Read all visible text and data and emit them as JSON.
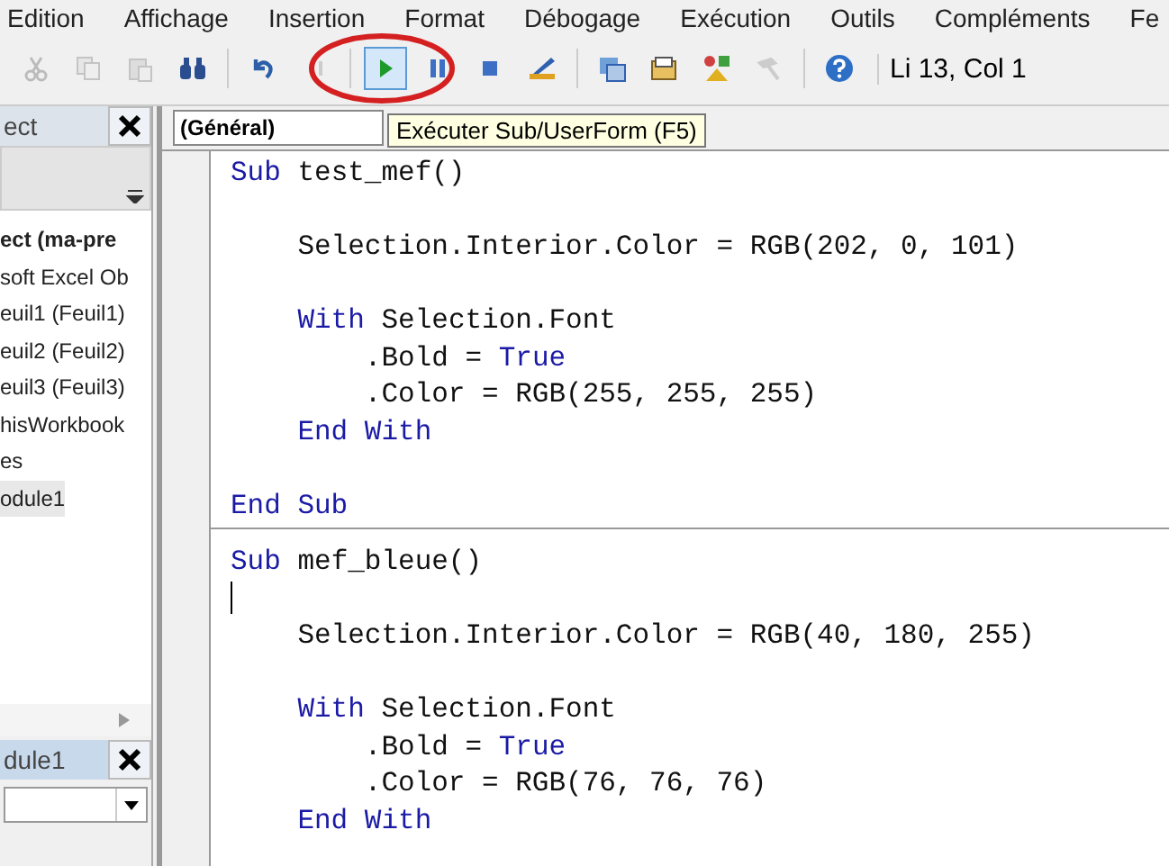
{
  "menu": [
    "Edition",
    "Affichage",
    "Insertion",
    "Format",
    "Débogage",
    "Exécution",
    "Outils",
    "Compléments",
    "Fe"
  ],
  "toolbar": {
    "buttons": [
      {
        "kind": "button",
        "disabled": true,
        "selected": false
      },
      {
        "kind": "button",
        "disabled": true,
        "selected": false
      },
      {
        "kind": "button",
        "disabled": true,
        "selected": false
      },
      {
        "kind": "button",
        "disabled": false,
        "selected": false
      },
      {
        "kind": "separator"
      },
      {
        "kind": "button",
        "disabled": false,
        "selected": false
      },
      {
        "kind": "button",
        "disabled": true,
        "selected": false
      },
      {
        "kind": "separator"
      },
      {
        "kind": "button",
        "disabled": false,
        "selected": true
      },
      {
        "kind": "button",
        "disabled": false,
        "selected": false
      },
      {
        "kind": "button",
        "disabled": false,
        "selected": false
      },
      {
        "kind": "button",
        "disabled": false,
        "selected": false
      },
      {
        "kind": "separator"
      },
      {
        "kind": "button",
        "disabled": false,
        "selected": false
      },
      {
        "kind": "button",
        "disabled": false,
        "selected": false
      },
      {
        "kind": "button",
        "disabled": false,
        "selected": false
      },
      {
        "kind": "button",
        "disabled": true,
        "selected": false
      },
      {
        "kind": "separator"
      },
      {
        "kind": "button",
        "disabled": false,
        "selected": false
      }
    ],
    "position": "Li 13, Col 1"
  },
  "project_panel": {
    "title": "ect",
    "items": [
      {
        "label": "ect (ma-pre",
        "bold": true,
        "selected": false
      },
      {
        "label": "soft Excel Ob",
        "bold": false,
        "selected": false
      },
      {
        "label": "euil1 (Feuil1)",
        "bold": false,
        "selected": false
      },
      {
        "label": "euil2 (Feuil2)",
        "bold": false,
        "selected": false
      },
      {
        "label": "euil3 (Feuil3)",
        "bold": false,
        "selected": false
      },
      {
        "label": "hisWorkbook",
        "bold": false,
        "selected": false
      },
      {
        "label": "es",
        "bold": false,
        "selected": false
      },
      {
        "label": "odule1",
        "bold": false,
        "selected": true
      }
    ]
  },
  "properties_panel": {
    "title": "dule1"
  },
  "editor": {
    "object_dropdown": "(Général)",
    "tooltip": "Exécuter Sub/UserForm (F5)",
    "procedures": [
      {
        "lines": [
          {
            "kind": "code",
            "tokens": [
              {
                "kind": "kw",
                "text": "Sub"
              },
              {
                "kind": "plain",
                "text": "test_mef()"
              }
            ]
          },
          {
            "kind": "group",
            "children": [
              {
                "kind": "blank"
              },
              {
                "kind": "code",
                "tokens": [
                  {
                    "kind": "plain",
                    "text": "Selection.Interior.Color = RGB(202, 0, 101)"
                  }
                ]
              },
              {
                "kind": "blank"
              },
              {
                "kind": "code",
                "tokens": [
                  {
                    "kind": "kw",
                    "text": "With"
                  },
                  {
                    "kind": "plain",
                    "text": "Selection.Font"
                  }
                ]
              },
              {
                "kind": "group",
                "children": [
                  {
                    "kind": "code",
                    "tokens": [
                      {
                        "kind": "plain",
                        "text": ".Bold ="
                      },
                      {
                        "kind": "kw",
                        "text": "True"
                      }
                    ]
                  },
                  {
                    "kind": "code",
                    "tokens": [
                      {
                        "kind": "plain",
                        "text": ".Color = RGB(255, 255, 255)"
                      }
                    ]
                  }
                ]
              },
              {
                "kind": "code",
                "tokens": [
                  {
                    "kind": "kw",
                    "text": "End With"
                  }
                ]
              },
              {
                "kind": "blank"
              }
            ]
          },
          {
            "kind": "code",
            "tokens": [
              {
                "kind": "kw",
                "text": "End Sub"
              }
            ]
          }
        ]
      },
      {
        "lines": [
          {
            "kind": "code",
            "tokens": [
              {
                "kind": "kw",
                "text": "Sub"
              },
              {
                "kind": "plain",
                "text": "mef_bleue()"
              }
            ]
          },
          {
            "kind": "cursor"
          },
          {
            "kind": "group",
            "children": [
              {
                "kind": "code",
                "tokens": [
                  {
                    "kind": "plain",
                    "text": "Selection.Interior.Color = RGB(40, 180, 255)"
                  }
                ]
              },
              {
                "kind": "blank"
              },
              {
                "kind": "code",
                "tokens": [
                  {
                    "kind": "kw",
                    "text": "With"
                  },
                  {
                    "kind": "plain",
                    "text": "Selection.Font"
                  }
                ]
              },
              {
                "kind": "group",
                "children": [
                  {
                    "kind": "code",
                    "tokens": [
                      {
                        "kind": "plain",
                        "text": ".Bold ="
                      },
                      {
                        "kind": "kw",
                        "text": "True"
                      }
                    ]
                  },
                  {
                    "kind": "code",
                    "tokens": [
                      {
                        "kind": "plain",
                        "text": ".Color = RGB(76, 76, 76)"
                      }
                    ]
                  }
                ]
              },
              {
                "kind": "code",
                "tokens": [
                  {
                    "kind": "kw",
                    "text": "End With"
                  }
                ]
              }
            ]
          }
        ]
      }
    ]
  }
}
